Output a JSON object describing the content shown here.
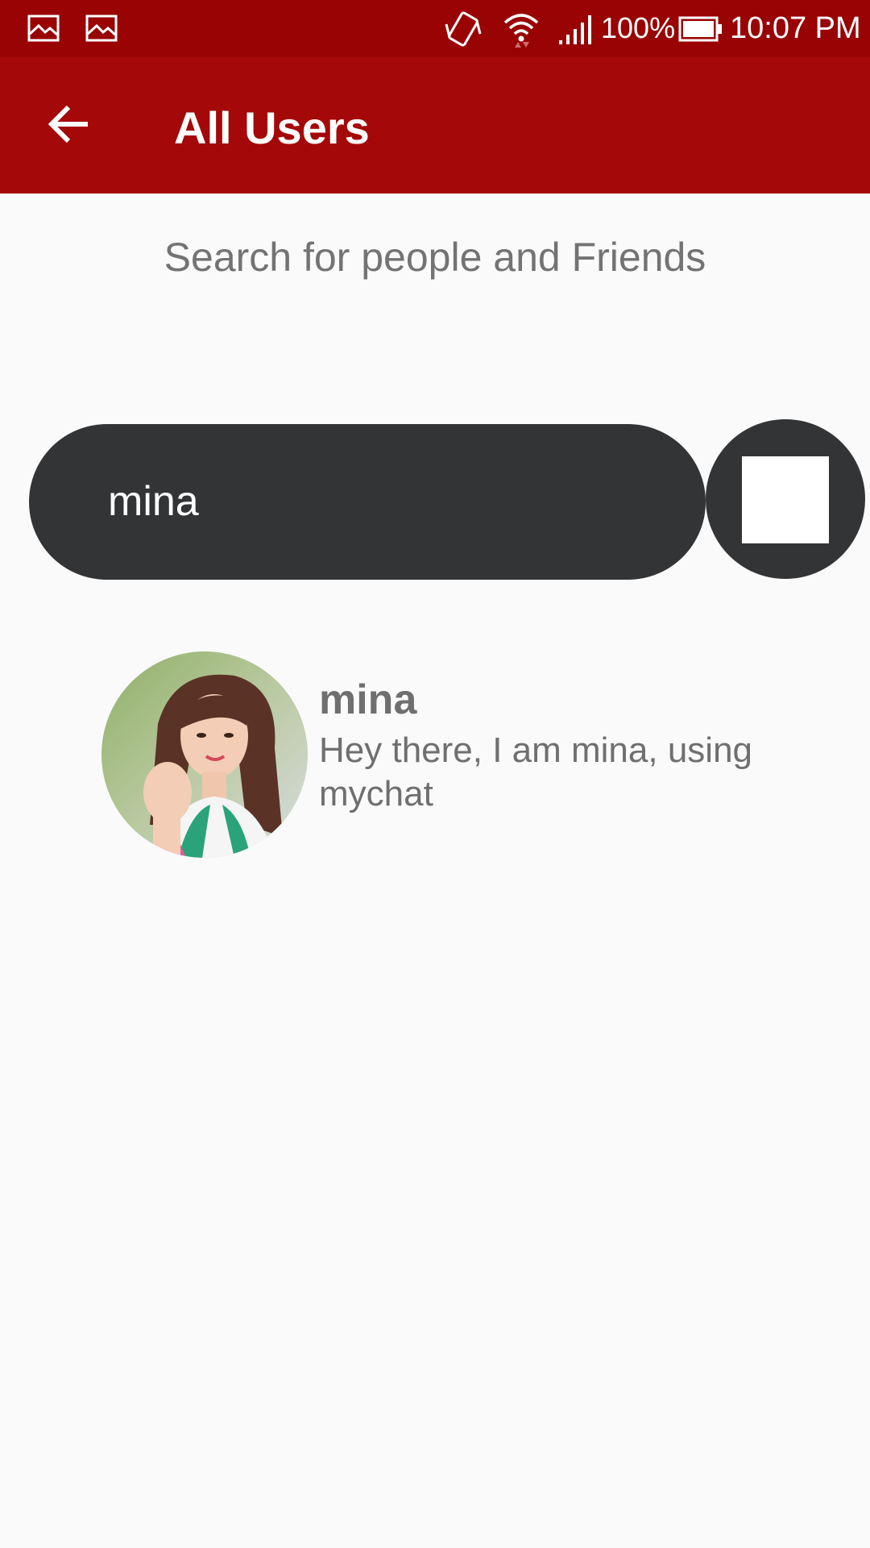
{
  "status_bar": {
    "notification_icons": [
      "image-icon",
      "image-icon"
    ],
    "right_icons": [
      "vibrate-icon",
      "wifi-icon",
      "signal-icon"
    ],
    "battery_percent": "100%",
    "time": "10:07 PM",
    "background_color": "#990303"
  },
  "app_bar": {
    "back_icon": "arrow-left-icon",
    "title": "All Users",
    "background_color": "#a50808"
  },
  "subtitle": "Search for people and Friends",
  "search": {
    "value": "mina",
    "button_icon": "square-icon"
  },
  "results": [
    {
      "name": "mina",
      "status": "Hey there, I am mina, using mychat",
      "avatar_icon": "user-avatar-photo"
    }
  ]
}
